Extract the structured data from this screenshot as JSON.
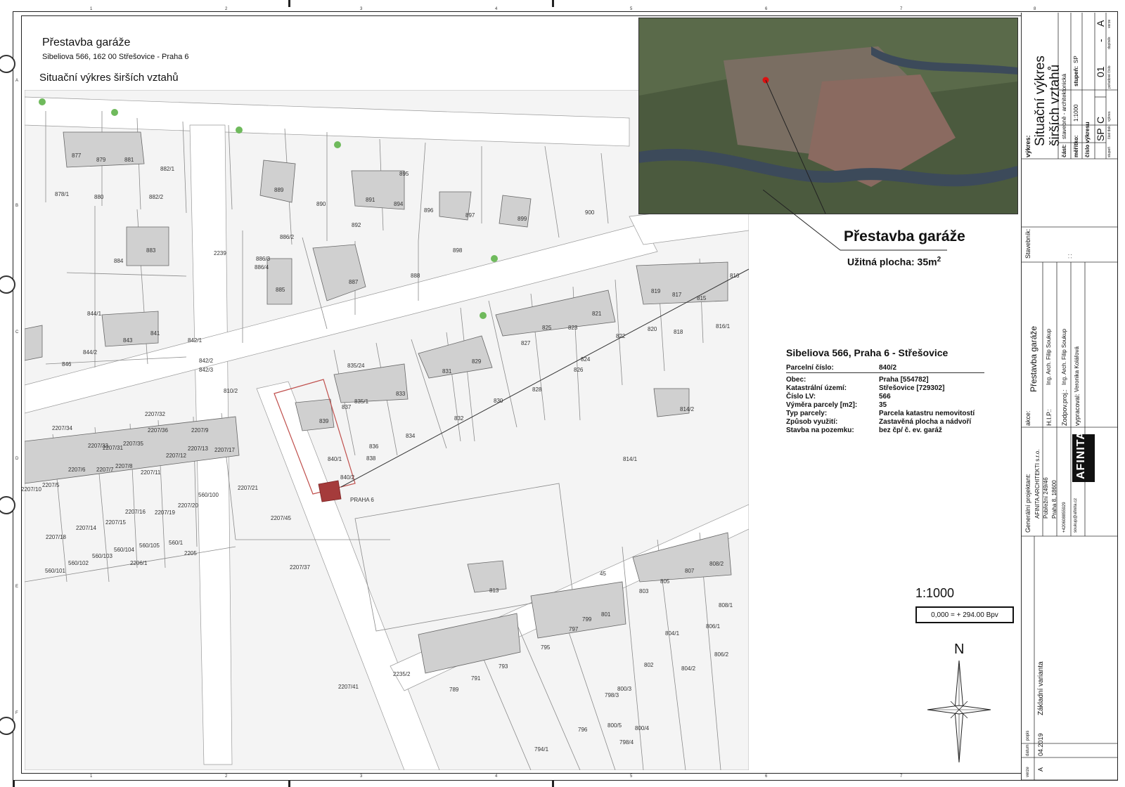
{
  "header": {
    "project": "Přestavba garáže",
    "address": "Sibeliova 566, 162 00 Střešovice - Praha 6",
    "drawing_title": "Situační výkres širších vztahů"
  },
  "callout": {
    "title": "Přestavba garáže",
    "area_label": "Užitná plocha: 35m",
    "area_sup": "2"
  },
  "info": {
    "title": "Sibeliova 566, Praha 6 - Střešovice",
    "parcel_key": "Parcelní číslo:",
    "parcel_val": "840/2",
    "rows": [
      {
        "k": "Obec:",
        "v": "Praha [554782]"
      },
      {
        "k": "Katastrální území:",
        "v": "Střešovice [729302]"
      },
      {
        "k": "Číslo LV:",
        "v": "566"
      },
      {
        "k": "Výměra parcely [m2]:",
        "v": "35"
      },
      {
        "k": "Typ parcely:",
        "v": "Parcela katastru nemovitostí"
      },
      {
        "k": "Způsob využití:",
        "v": "Zastavěná plocha a nádvoří"
      },
      {
        "k": "Stavba na pozemku:",
        "v": "bez čp/ č. ev. garáž"
      }
    ]
  },
  "scale": "1:1000",
  "elevation": "0,000 = + 294.00 Bpv",
  "north_label": "N",
  "map_labels": {
    "parcels": [
      "877",
      "879",
      "881",
      "882/1",
      "878/1",
      "880",
      "882/2",
      "889",
      "890",
      "891",
      "894",
      "895",
      "896",
      "897",
      "899",
      "900",
      "892",
      "883",
      "884",
      "886/2",
      "886/3",
      "886/4",
      "885",
      "887",
      "888",
      "898",
      "844/1",
      "843",
      "841",
      "842/1",
      "846",
      "844/2",
      "842/2",
      "842/3",
      "819",
      "817",
      "815",
      "816",
      "821",
      "823",
      "825",
      "827",
      "820",
      "818",
      "822",
      "816/1",
      "826",
      "824",
      "831",
      "829",
      "828",
      "830",
      "835/24",
      "837",
      "835/1",
      "833",
      "839",
      "832",
      "836",
      "834",
      "840/1",
      "838",
      "840/2",
      "814/2",
      "814/1",
      "813",
      "803",
      "805",
      "807",
      "808/2",
      "808/1",
      "801",
      "799",
      "797",
      "795",
      "804/1",
      "806/1",
      "806/2",
      "804/2",
      "802",
      "793",
      "791",
      "789",
      "798/3",
      "800/3",
      "800/5",
      "800/4",
      "798/4",
      "796",
      "794/1",
      "2235/2",
      "2207/41",
      "2207/37",
      "2207/21",
      "2207/45",
      "2207/32",
      "2207/34",
      "2207/33",
      "2207/31",
      "2207/35",
      "2207/36",
      "2207/9",
      "2207/8",
      "2207/7",
      "2207/6",
      "2207/5",
      "2207/10",
      "2207/11",
      "2207/12",
      "2207/13",
      "2207/17",
      "2207/16",
      "2207/15",
      "2207/14",
      "2207/18",
      "2207/19",
      "2207/20",
      "560/100",
      "560/101",
      "560/102",
      "560/103",
      "560/104",
      "560/105",
      "560/1",
      "2205",
      "2206/1",
      "2239",
      "810/2",
      "45"
    ],
    "praha6": "PRAHA 6"
  },
  "title_block": {
    "vykres_label": "výkres:",
    "vykres_title1": "Situační výkres",
    "vykres_title2": "širších vztahů",
    "cast_label": "část:",
    "cast_val": "stavebně - architektonická",
    "meritko_label": "měřítko:",
    "meritko_val": "1:1000",
    "stupen_label": "stupeň:",
    "stupen_val": "SP",
    "cislo_label": "číslo výkresu",
    "cislo_stupen": "SP",
    "cislo_cast": "C",
    "cislo_num": "01",
    "cislo_dash": "-",
    "cislo_verze": "A",
    "col_stupen": "stupeň",
    "col_cast": "část dok.",
    "col_vykres": "výkres",
    "col_poradove": "pořadové číslo",
    "col_doplnek": "doplněk",
    "col_verze": "verze",
    "stavebnik_label": "Stavebník:",
    "stavebnik_val": ": :",
    "akce_label": "akce:",
    "akce_val": "Přestavba garáže",
    "hip_label": "H.I.P.:",
    "hip_val": "Ing. Arch. Filip Soukup",
    "zodp_label": "Zodpov.proj.:",
    "zodp_val": "Ing. Arch. Filip Soukup",
    "vypracoval_label": "vypracoval:",
    "vypracoval_val": "Veronika Kolářová",
    "gen_label": "Generální projektant:",
    "firm": "AFINITA ARCHITEKTI s.r.o.",
    "street": "Pobřežní 249/46",
    "city": "Praha 8, 18600",
    "phone": "+420608855929",
    "email": "soukup@afinita.cz",
    "logo": "AFINITA",
    "popis_label": "popis",
    "popis_val": "Základní varianta",
    "datum_label": "datum",
    "datum_val": "04.2019",
    "verze_label": "verze",
    "verze_val": "A"
  },
  "ruler": {
    "cols": [
      "1",
      "2",
      "3",
      "4",
      "5",
      "6",
      "7",
      "8"
    ],
    "rows": [
      "A",
      "B",
      "C",
      "D",
      "E",
      "F"
    ]
  },
  "colors": {
    "plot_fill": "#a53b3b",
    "plot_outline": "#c0504d",
    "building_fill": "#cfcfcf",
    "tree_green": "#6fba5c"
  }
}
